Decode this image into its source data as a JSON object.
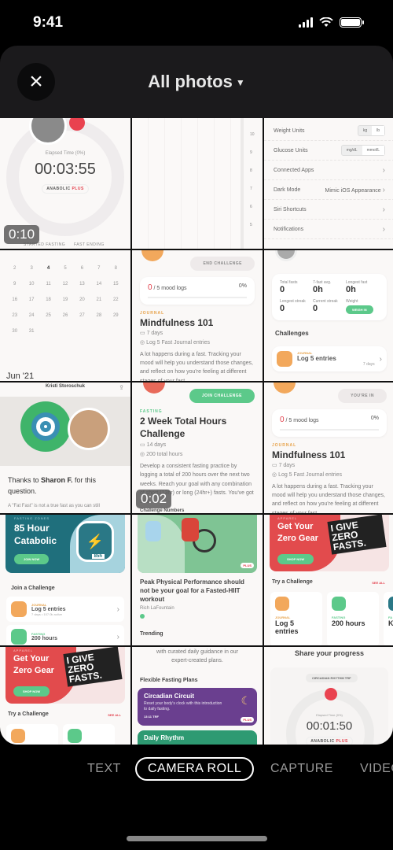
{
  "status_bar": {
    "time": "9:41"
  },
  "header": {
    "title": "All photos",
    "close_label": "×"
  },
  "grid": {
    "timer1": {
      "elapsed_label": "Elapsed Time (0%)",
      "time": "00:03:55",
      "badge": "ANABOLIC",
      "badge_plus": "PLUS",
      "started": "STARTED FASTING",
      "ending": "FAST ENDING",
      "duration": "0:10"
    },
    "chart_axis": {
      "ticks": [
        "10",
        "9",
        "8",
        "7",
        "6",
        "5"
      ]
    },
    "settings": {
      "rows": [
        {
          "label": "Weight Units",
          "options": [
            "kg",
            "lb"
          ]
        },
        {
          "label": "Glucose Units",
          "options": [
            "mg/dL",
            "mmol/L"
          ]
        },
        {
          "label": "Connected Apps",
          "value": ""
        },
        {
          "label": "Dark Mode",
          "value": "Mimic iOS Appearance"
        },
        {
          "label": "Siri Shortcuts",
          "value": ""
        },
        {
          "label": "Notifications",
          "value": ""
        }
      ]
    },
    "calendar": {
      "days": [
        "2",
        "3",
        "4",
        "5",
        "6",
        "7",
        "8",
        "9",
        "10",
        "11",
        "12",
        "13",
        "14",
        "15",
        "16",
        "17",
        "18",
        "19",
        "20",
        "21",
        "22",
        "23",
        "24",
        "25",
        "26",
        "27",
        "28",
        "29",
        "30",
        "31"
      ],
      "month": "Jun '21"
    },
    "mindfulness1": {
      "button": "END CHALLENGE",
      "progress_count": "0",
      "progress_total": " / 5 mood logs",
      "progress_pct": "0%",
      "tag": "JOURNAL",
      "title": "Mindfulness 101",
      "days": "7 days",
      "goal": "Log 5 Fast Journal entries",
      "body": "A lot happens during a fast. Tracking your mood will help you understand those changes, and reflect on how you're feeling at different stages of your fast."
    },
    "stats": {
      "items": [
        {
          "label": "Total fasts",
          "value": "0"
        },
        {
          "label": "7-fast avg.",
          "value": "0h"
        },
        {
          "label": "Longest fast",
          "value": "0h"
        },
        {
          "label": "Longest streak",
          "value": "0"
        },
        {
          "label": "Current streak",
          "value": "0"
        }
      ],
      "weight_label": "Weight",
      "weigh_in": "WEIGH IN",
      "challenges_title": "Challenges",
      "challenge_tag": "JOURNAL",
      "challenge_name": "Log 5 entries",
      "challenge_days": "7 days"
    },
    "article": {
      "author": "Kristi Storoschuk",
      "thanks_pre": "Thanks to ",
      "thanks_name": "Sharon F.",
      "thanks_post": " for this question.",
      "body": "A \"Fat Fast\" is not a true fast as you can still"
    },
    "two_week": {
      "button": "JOIN CHALLENGE",
      "tag": "FASTING",
      "title": "2 Week Total Hours Challenge",
      "days": "14 days",
      "goal": "200 total hours",
      "body": "Develop a consistent fasting practice by logging a total of 200 hours over the next two weeks. Reach your goal with any combination of short (13hr) or long (24hr+) fasts. You've got this!",
      "footer": "Challenge Numbers",
      "duration": "0:02"
    },
    "mindfulness2": {
      "button": "YOU'RE IN",
      "progress_count": "0",
      "progress_total": " / 5 mood logs",
      "progress_pct": "0%",
      "tag": "JOURNAL",
      "title": "Mindfulness 101",
      "days": "7 days",
      "goal": "Log 5 Fast Journal entries",
      "body": "A lot happens during a fast. Tracking your mood will help you understand those changes, and reflect on how you're feeling at different stages of your fast."
    },
    "zones": {
      "tag": "FASTING ZONES",
      "title": "85 Hour Catabolic",
      "button": "JOIN NOW",
      "badge": "85h",
      "join_title": "Join a Challenge",
      "c1_tag": "JOURNAL",
      "c1_name": "Log 5 entries",
      "c1_meta": "7 days • 107.0k active",
      "c2_tag": "FASTING",
      "c2_name": "200 hours"
    },
    "hiit": {
      "plus": "PLUS",
      "title": "Peak Physical Performance should not be your goal for a Fasted-HIIT workout",
      "author": "Rich LaFountain",
      "trending": "Trending"
    },
    "gear1": {
      "tag": "APPAREL",
      "title": "Get Your Zero Gear",
      "button": "SHOP NOW",
      "shirt": "I GIVE ZERO FASTS.",
      "try_title": "Try a Challenge",
      "see_all": "SEE ALL",
      "c1_tag": "JOURNAL",
      "c1_name": "Log 5 entries",
      "c2_tag": "FASTING",
      "c2_name": "200 hours",
      "c3_tag": "FA",
      "c3_name": "Ke"
    },
    "plans": {
      "intro": "with curated daily guidance in our expert-created plans.",
      "section": "Flexible Fasting Plans",
      "p1_title": "Circadian Circuit",
      "p1_body": "Reset your body's clock with this introduction to daily fasting.",
      "p1_tag": "13:11 TRF",
      "p1_plus": "PLUS",
      "p2_title": "Daily Rhythm"
    },
    "gear2": {
      "tag": "APPAREL",
      "title": "Get Your Zero Gear",
      "button": "SHOP NOW",
      "shirt": "I GIVE ZERO FASTS.",
      "try_title": "Try a Challenge",
      "see_all": "SEE ALL"
    },
    "share": {
      "title": "Share your progress",
      "plan": "CIRCADIAN RHYTHM TRF",
      "elapsed_label": "Elapsed Time (0%)",
      "time": "00:01:50",
      "badge": "ANABOLIC",
      "badge_plus": "PLUS"
    }
  },
  "mode_tabs": [
    {
      "label": "TEXT",
      "selected": false
    },
    {
      "label": "CAMERA ROLL",
      "selected": true
    },
    {
      "label": "CAPTURE",
      "selected": false
    },
    {
      "label": "VIDEO",
      "selected": false
    }
  ],
  "colors": {
    "accent_green": "#5cc98a",
    "accent_red": "#e3414d",
    "journal_orange": "#e7a24a",
    "sheet_bg": "#1b1a1c"
  }
}
